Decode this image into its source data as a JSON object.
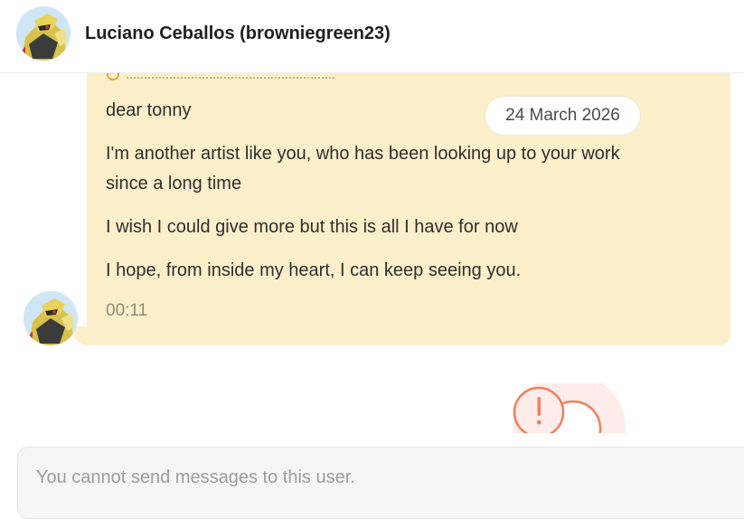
{
  "header": {
    "title": "Luciano Ceballos (browniegreen23)",
    "avatar_icon": "user-avatar-icon"
  },
  "message": {
    "date": "24 March 2026",
    "lines": [
      "dear tonny",
      "I'm another artist like you, who has been looking up to your work",
      "since a long time",
      "I wish I could give more but this is all I have for now",
      "I hope, from inside my heart, I can keep seeing you."
    ],
    "time": "00:11",
    "bubble_color": "#fcefc9"
  },
  "blocked": {
    "icon": "warning-icon",
    "accent": "#f0805c"
  },
  "composer": {
    "placeholder": "You cannot send messages to this user."
  }
}
